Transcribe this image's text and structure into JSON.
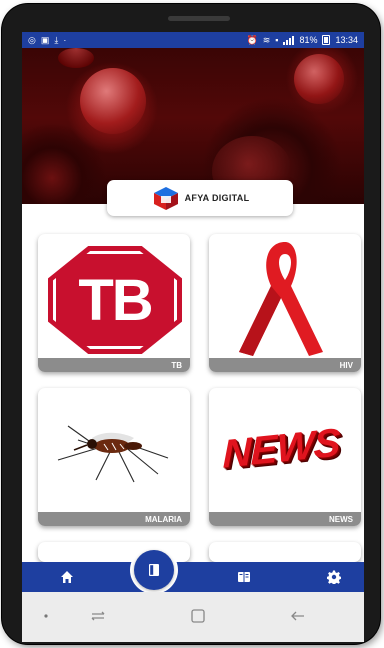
{
  "status_bar": {
    "battery": "81%",
    "time": "13:34"
  },
  "app": {
    "brand": "AFYA DIGITAL"
  },
  "tiles": [
    {
      "label": "TB",
      "image_text": "TB"
    },
    {
      "label": "HIV"
    },
    {
      "label": "MALARIA"
    },
    {
      "label": "NEWS",
      "image_text": "NEWS"
    }
  ],
  "bottom_nav": {
    "items": [
      "home-icon",
      "bookmark-icon",
      "book-icon",
      "gear-icon"
    ]
  },
  "colors": {
    "primary": "#1e3fa0",
    "tile_label_bg": "#8c8c8c",
    "accent_red": "#c8102e"
  }
}
